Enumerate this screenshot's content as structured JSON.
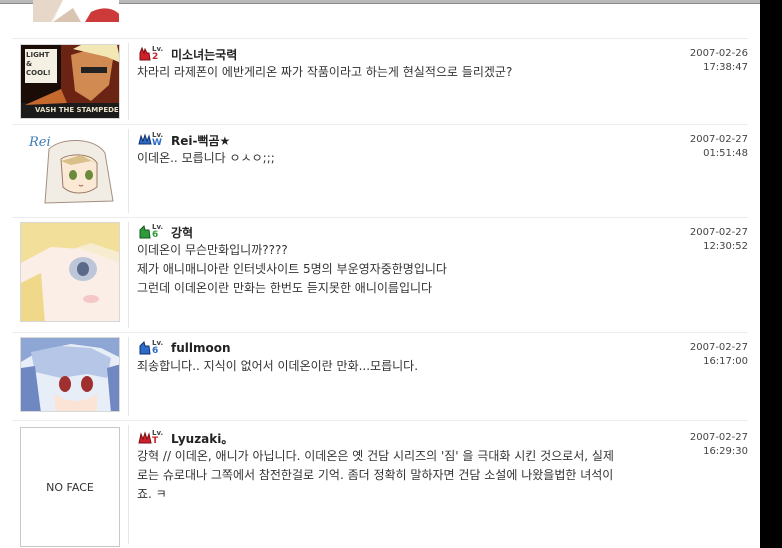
{
  "comments": [
    {
      "level": "2",
      "level_prefix": "Lv.",
      "username": "미소녀는국력",
      "message": "차라리 라제폰이 에반게리온 짜가 작품이라고 하는게 현실적으로 들리겠군?",
      "date": "2007-02-26",
      "time": "17:38:47",
      "avatar_caption": "VASH THE STAMPEDE",
      "avatar_text": "LIGHT & COOL!"
    },
    {
      "level": "W",
      "level_prefix": "Lv.",
      "username": "Rei-뻑곰★",
      "message": "이데온.. 모릅니다 ㅇㅅㅇ;;;",
      "date": "2007-02-27",
      "time": "01:51:48",
      "avatar_text": "Rei"
    },
    {
      "level": "6",
      "level_prefix": "Lv.",
      "username": "강혁",
      "message_lines": [
        "이데온이 무슨만화입니까????",
        "제가 애니매니아란 인터넷사이트 5명의 부운영자중한명입니다",
        "그런데 이데온이란 만화는 한번도 듣지못한 애니이름입니다"
      ],
      "date": "2007-02-27",
      "time": "12:30:52"
    },
    {
      "level": "6",
      "level_prefix": "Lv.",
      "username": "fullmoon",
      "message": "죄송합니다.. 지식이 없어서 이데온이란 만화...모릅니다.",
      "date": "2007-02-27",
      "time": "16:17:00"
    },
    {
      "level": "T",
      "level_prefix": "Lv.",
      "username": "Lyuzaki。",
      "message_lines": [
        "강혁 // 이데온, 애니가 아닙니다. 이데온은 옛 건담 시리즈의 '짐' 을 극대화 시킨 것으로서, 실제",
        "로는 슈로대나 그쪽에서 참전한걸로 기억. 좀더 정확히 말하자면 건담 소설에 나왔을법한 녀석이",
        "죠. ㅋ"
      ],
      "date": "2007-02-27",
      "time": "16:29:30",
      "avatar_text": "NO FACE"
    }
  ],
  "colors": {
    "level_red": "#d0202a",
    "level_blue": "#2a6cc8",
    "level_green": "#2e9a3a",
    "scrollbar": "#000000"
  }
}
